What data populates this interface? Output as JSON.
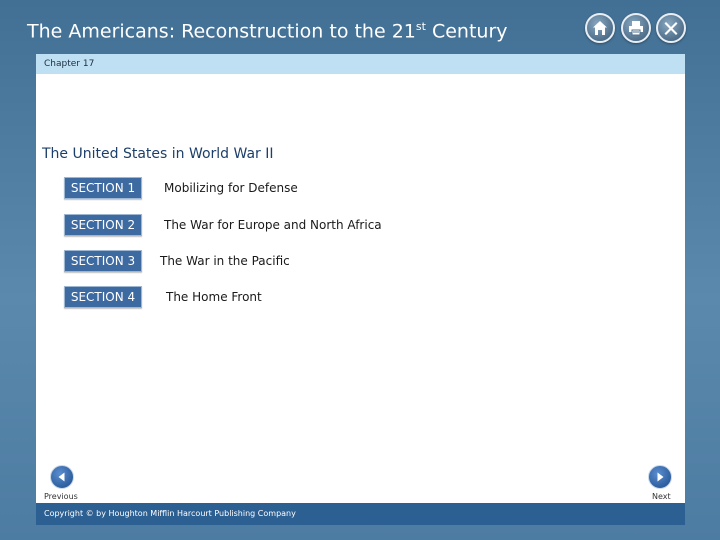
{
  "header": {
    "title_before": "The Americans: Reconstruction to the 21",
    "title_sup": "st",
    "title_after": " Century",
    "icons": [
      "home-icon",
      "print-icon",
      "close-icon"
    ]
  },
  "chapter_bar": {
    "label": "Chapter 17"
  },
  "lesson": {
    "title": "The United States in World War II"
  },
  "sections": [
    {
      "button": "SECTION 1",
      "text": "Mobilizing for Defense"
    },
    {
      "button": "SECTION 2",
      "text": "The War for Europe and North Africa"
    },
    {
      "button": "SECTION 3",
      "text": "The War in the Pacific"
    },
    {
      "button": "SECTION 4",
      "text": "The Home Front"
    }
  ],
  "navigation": {
    "previous_label": "Previous",
    "next_label": "Next"
  },
  "footer": {
    "copyright": "Copyright © by Houghton Mifflin Harcourt Publishing Company"
  },
  "colors": {
    "frame": "#4f7fa3",
    "chapter_bar": "#bfe0f2",
    "section_button": "#3d6aa0",
    "title_text": "#1d3f69",
    "footer_bar": "#2c5f92"
  }
}
